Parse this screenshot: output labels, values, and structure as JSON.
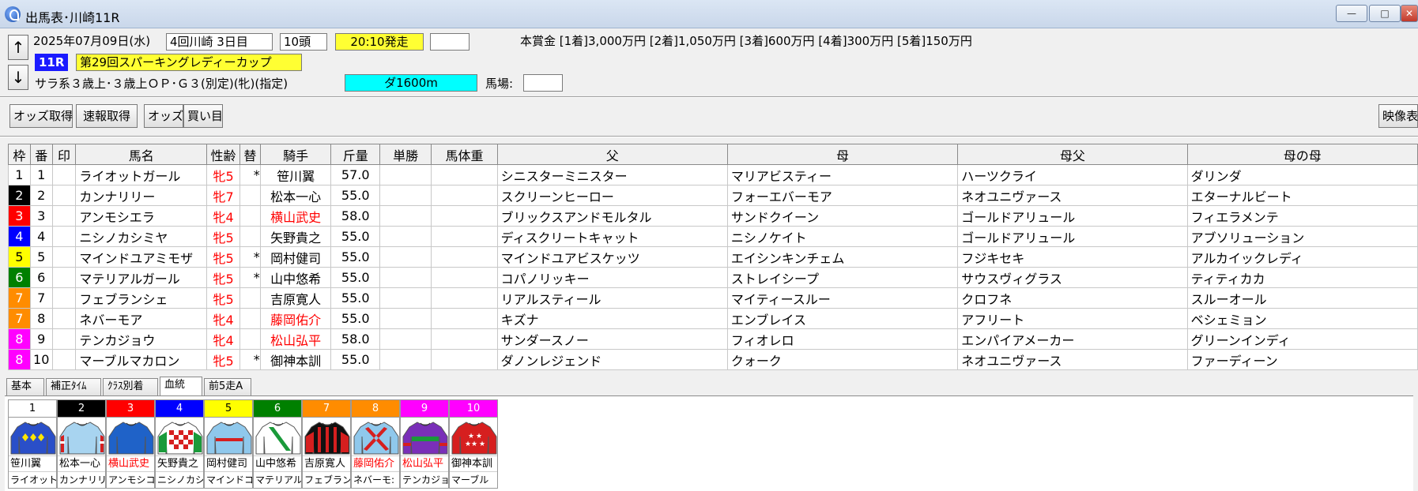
{
  "window": {
    "title": "出馬表･川崎11R",
    "minimize_label": "—",
    "maximize_label": "□",
    "close_label": "✕"
  },
  "header": {
    "up_arrow": "↑",
    "down_arrow": "↓",
    "date": "2025年07月09日(水)",
    "meeting": "4回川崎 3日目",
    "runners": "10頭",
    "post_time": "20:10発走",
    "blank_box": "",
    "prize": "本賞金 [1着]3,000万円 [2着]1,050万円 [3着]600万円 [4着]300万円 [5着]150万円",
    "race_number": "11R",
    "race_name": "第29回スパーキングレディーカップ",
    "conditions": "サラ系３歳上･３歳上ＯＰ･Ｇ３(別定)(牝)(指定)",
    "distance": "ダ1600m",
    "track_label": "馬場:",
    "track_value": ""
  },
  "toolbar": {
    "odds_fetch": "オッズ取得",
    "quick_fetch": "速報取得",
    "odds": "オッズ",
    "bets": "買い目",
    "video": "映像表示"
  },
  "table": {
    "headers": [
      "枠",
      "番",
      "印",
      "馬名",
      "性齢",
      "替",
      "騎手",
      "斤量",
      "単勝",
      "馬体重",
      "父",
      "母",
      "母父",
      "母の母"
    ],
    "rows": [
      {
        "waku": "1",
        "ban": "1",
        "mark": "",
        "name": "ライオットガール",
        "sex_age": "牝5",
        "change": "*",
        "jockey": "笹川翼",
        "weight": "57.0",
        "win": "",
        "body": "",
        "sire": "シニスターミニスター",
        "dam": "マリアビスティー",
        "damsire": "ハーツクライ",
        "damdam": "ダリンダ"
      },
      {
        "waku": "2",
        "ban": "2",
        "mark": "",
        "name": "カンナリリー",
        "sex_age": "牝7",
        "change": "",
        "jockey": "松本一心",
        "weight": "55.0",
        "win": "",
        "body": "",
        "sire": "スクリーンヒーロー",
        "dam": "フォーエバーモア",
        "damsire": "ネオユニヴァース",
        "damdam": "エターナルビート"
      },
      {
        "waku": "3",
        "ban": "3",
        "mark": "",
        "name": "アンモシエラ",
        "sex_age": "牝4",
        "change": "",
        "jockey": "横山武史",
        "weight": "58.0",
        "win": "",
        "body": "",
        "sire": "ブリックスアンドモルタル",
        "dam": "サンドクイーン",
        "damsire": "ゴールドアリュール",
        "damdam": "フィエラメンテ"
      },
      {
        "waku": "4",
        "ban": "4",
        "mark": "",
        "name": "ニシノカシミヤ",
        "sex_age": "牝5",
        "change": "",
        "jockey": "矢野貴之",
        "weight": "55.0",
        "win": "",
        "body": "",
        "sire": "ディスクリートキャット",
        "dam": "ニシノケイト",
        "damsire": "ゴールドアリュール",
        "damdam": "アブソリューション"
      },
      {
        "waku": "5",
        "ban": "5",
        "mark": "",
        "name": "マインドユアミモザ",
        "sex_age": "牝5",
        "change": "*",
        "jockey": "岡村健司",
        "weight": "55.0",
        "win": "",
        "body": "",
        "sire": "マインドユアビスケッツ",
        "dam": "エイシンキンチェム",
        "damsire": "フジキセキ",
        "damdam": "アルカイックレディ"
      },
      {
        "waku": "6",
        "ban": "6",
        "mark": "",
        "name": "マテリアルガール",
        "sex_age": "牝5",
        "change": "*",
        "jockey": "山中悠希",
        "weight": "55.0",
        "win": "",
        "body": "",
        "sire": "コパノリッキー",
        "dam": "ストレイシープ",
        "damsire": "サウスヴィグラス",
        "damdam": "ティティカカ"
      },
      {
        "waku": "7",
        "ban": "7",
        "mark": "",
        "name": "フェブランシェ",
        "sex_age": "牝5",
        "change": "",
        "jockey": "吉原寛人",
        "weight": "55.0",
        "win": "",
        "body": "",
        "sire": "リアルスティール",
        "dam": "マイティースルー",
        "damsire": "クロフネ",
        "damdam": "スルーオール"
      },
      {
        "waku": "7",
        "ban": "8",
        "mark": "",
        "name": "ネバーモア",
        "sex_age": "牝4",
        "change": "",
        "jockey": "藤岡佑介",
        "weight": "55.0",
        "win": "",
        "body": "",
        "sire": "キズナ",
        "dam": "エンブレイス",
        "damsire": "アフリート",
        "damdam": "ベシェミョン"
      },
      {
        "waku": "8",
        "ban": "9",
        "mark": "",
        "name": "テンカジョウ",
        "sex_age": "牝4",
        "change": "",
        "jockey": "松山弘平",
        "weight": "58.0",
        "win": "",
        "body": "",
        "sire": "サンダースノー",
        "dam": "フィオレロ",
        "damsire": "エンパイアメーカー",
        "damdam": "グリーンインディ"
      },
      {
        "waku": "8",
        "ban": "10",
        "mark": "",
        "name": "マーブルマカロン",
        "sex_age": "牝5",
        "change": "*",
        "jockey": "御神本訓",
        "weight": "55.0",
        "win": "",
        "body": "",
        "sire": "ダノンレジェンド",
        "dam": "クォーク",
        "damsire": "ネオユニヴァース",
        "damdam": "ファーディーン"
      }
    ],
    "red_jockeys": [
      "横山武史",
      "藤岡佑介",
      "松山弘平"
    ]
  },
  "tabs": [
    "基本",
    "補正ﾀｲﾑ",
    "ｸﾗｽ別着",
    "血統",
    "前5走A"
  ],
  "active_tab": "血統",
  "waku_colors": {
    "1": {
      "bg": "#ffffff",
      "fg": "#000000"
    },
    "2": {
      "bg": "#000000",
      "fg": "#ffffff"
    },
    "3": {
      "bg": "#ff0000",
      "fg": "#ffffff"
    },
    "4": {
      "bg": "#0000ff",
      "fg": "#ffffff"
    },
    "5": {
      "bg": "#ffff00",
      "fg": "#000000"
    },
    "6": {
      "bg": "#008000",
      "fg": "#ffffff"
    },
    "7": {
      "bg": "#ff8c00",
      "fg": "#ffffff"
    },
    "8": {
      "bg": "#ff00ff",
      "fg": "#ffffff"
    }
  },
  "silks": [
    {
      "num": "1",
      "waku": "1",
      "jockey": "笹川翼",
      "horse": "ライオット:",
      "body": "#2a4fc8",
      "pattern": "diamonds",
      "accent": "#ffe600"
    },
    {
      "num": "2",
      "waku": "2",
      "jockey": "松本一心",
      "horse": "カンナリリ",
      "body": "#a8d4f0",
      "pattern": "sleeves",
      "accent": "#d61f1f"
    },
    {
      "num": "3",
      "waku": "3",
      "jockey": "横山武史",
      "horse": "アンモシコ",
      "body": "#1f62c8",
      "pattern": "plain",
      "accent": "#1f62c8"
    },
    {
      "num": "4",
      "waku": "4",
      "jockey": "矢野貴之",
      "horse": "ニシノカシ",
      "body": "#ffffff",
      "pattern": "checks",
      "accent": "#d61f1f"
    },
    {
      "num": "5",
      "waku": "5",
      "jockey": "岡村健司",
      "horse": "マインドコ",
      "body": "#8fc8ec",
      "pattern": "belt",
      "accent": "#d61f1f"
    },
    {
      "num": "6",
      "waku": "6",
      "jockey": "山中悠希",
      "horse": "マテリアル",
      "body": "#ffffff",
      "pattern": "sash",
      "accent": "#1a9a3a"
    },
    {
      "num": "7",
      "waku": "7",
      "jockey": "吉原寛人",
      "horse": "フェブラン",
      "body": "#111111",
      "pattern": "stripes",
      "accent": "#d61f1f"
    },
    {
      "num": "8",
      "waku": "7",
      "jockey": "藤岡佑介",
      "horse": "ネバーモ:",
      "body": "#8fc8ec",
      "pattern": "cross",
      "accent": "#d61f1f"
    },
    {
      "num": "9",
      "waku": "8",
      "jockey": "松山弘平",
      "horse": "テンカジョ",
      "body": "#7a2fb8",
      "pattern": "band",
      "accent": "#1a9a3a"
    },
    {
      "num": "10",
      "waku": "8",
      "jockey": "御神本訓",
      "horse": "マーブル",
      "body": "#d61f1f",
      "pattern": "stars",
      "accent": "#ffffff"
    }
  ]
}
